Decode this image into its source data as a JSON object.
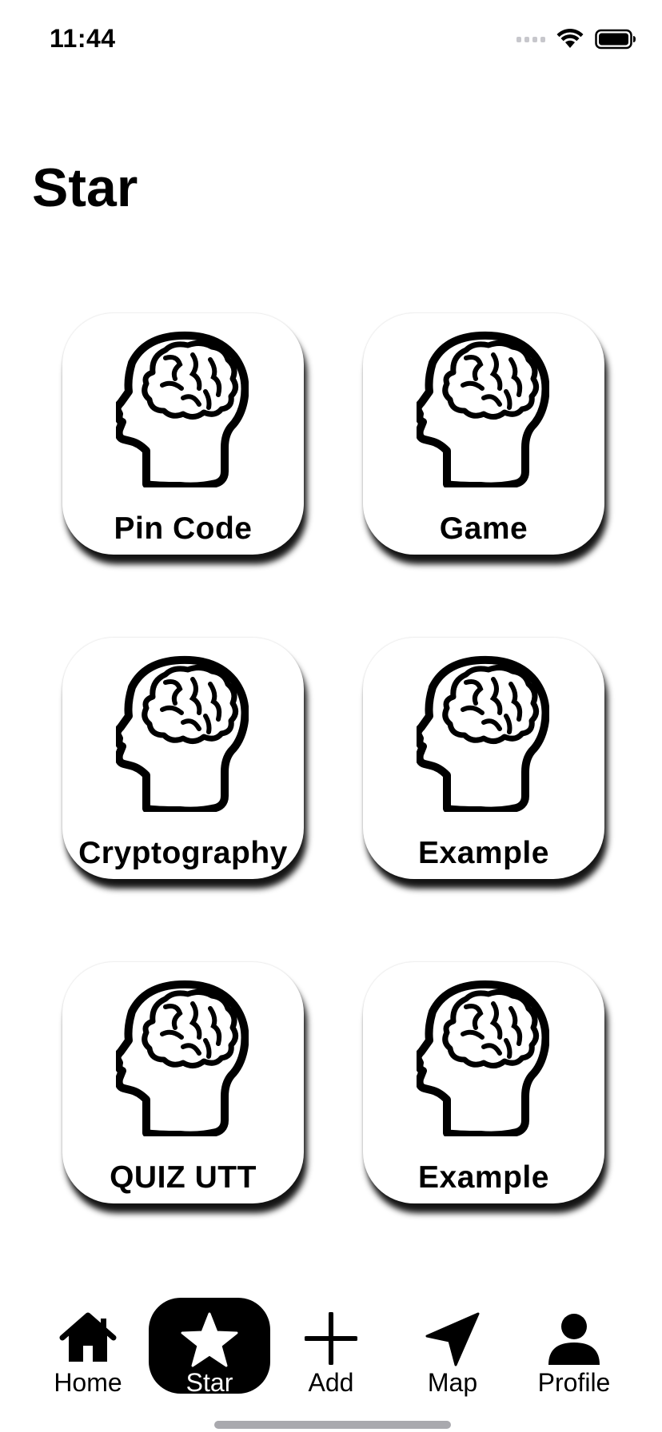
{
  "status_bar": {
    "time": "11:44"
  },
  "page": {
    "title": "Star"
  },
  "tiles": [
    {
      "label": "Pin Code",
      "icon": "brain-head-icon"
    },
    {
      "label": "Game",
      "icon": "brain-head-icon"
    },
    {
      "label": "Cryptography",
      "icon": "brain-head-icon"
    },
    {
      "label": "Example",
      "icon": "brain-head-icon"
    },
    {
      "label": "QUIZ UTT",
      "icon": "brain-head-icon"
    },
    {
      "label": "Example",
      "icon": "brain-head-icon"
    }
  ],
  "tab_bar": {
    "items": [
      {
        "label": "Home",
        "icon": "home-icon",
        "active": false
      },
      {
        "label": "Star",
        "icon": "star-icon",
        "active": true
      },
      {
        "label": "Add",
        "icon": "plus-icon",
        "active": false
      },
      {
        "label": "Map",
        "icon": "location-arrow-icon",
        "active": false
      },
      {
        "label": "Profile",
        "icon": "person-icon",
        "active": false
      }
    ]
  },
  "colors": {
    "background": "#ffffff",
    "foreground": "#000000",
    "active_tab_background": "#000000",
    "active_tab_foreground": "#ffffff"
  }
}
